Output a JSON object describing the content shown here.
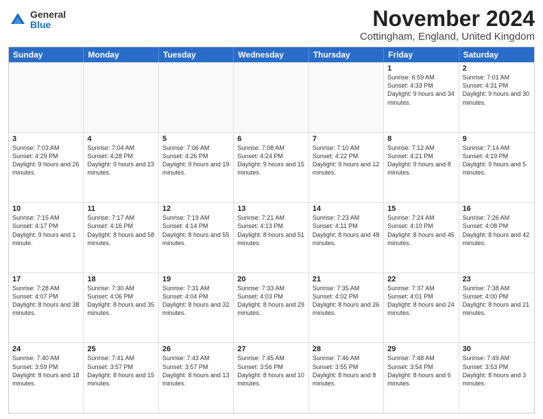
{
  "header": {
    "logo_general": "General",
    "logo_blue": "Blue",
    "month_title": "November 2024",
    "location": "Cottingham, England, United Kingdom"
  },
  "days_of_week": [
    "Sunday",
    "Monday",
    "Tuesday",
    "Wednesday",
    "Thursday",
    "Friday",
    "Saturday"
  ],
  "rows": [
    [
      {
        "day": "",
        "empty": true,
        "text": ""
      },
      {
        "day": "",
        "empty": true,
        "text": ""
      },
      {
        "day": "",
        "empty": true,
        "text": ""
      },
      {
        "day": "",
        "empty": true,
        "text": ""
      },
      {
        "day": "",
        "empty": true,
        "text": ""
      },
      {
        "day": "1",
        "empty": false,
        "text": "Sunrise: 6:59 AM\nSunset: 4:33 PM\nDaylight: 9 hours and 34 minutes."
      },
      {
        "day": "2",
        "empty": false,
        "text": "Sunrise: 7:01 AM\nSunset: 4:31 PM\nDaylight: 9 hours and 30 minutes."
      }
    ],
    [
      {
        "day": "3",
        "empty": false,
        "shaded": false,
        "text": "Sunrise: 7:03 AM\nSunset: 4:29 PM\nDaylight: 9 hours and 26 minutes."
      },
      {
        "day": "4",
        "empty": false,
        "text": "Sunrise: 7:04 AM\nSunset: 4:28 PM\nDaylight: 9 hours and 23 minutes."
      },
      {
        "day": "5",
        "empty": false,
        "text": "Sunrise: 7:06 AM\nSunset: 4:26 PM\nDaylight: 9 hours and 19 minutes."
      },
      {
        "day": "6",
        "empty": false,
        "text": "Sunrise: 7:08 AM\nSunset: 4:24 PM\nDaylight: 9 hours and 15 minutes."
      },
      {
        "day": "7",
        "empty": false,
        "text": "Sunrise: 7:10 AM\nSunset: 4:22 PM\nDaylight: 9 hours and 12 minutes."
      },
      {
        "day": "8",
        "empty": false,
        "text": "Sunrise: 7:12 AM\nSunset: 4:21 PM\nDaylight: 9 hours and 8 minutes."
      },
      {
        "day": "9",
        "empty": false,
        "text": "Sunrise: 7:14 AM\nSunset: 4:19 PM\nDaylight: 9 hours and 5 minutes."
      }
    ],
    [
      {
        "day": "10",
        "empty": false,
        "text": "Sunrise: 7:15 AM\nSunset: 4:17 PM\nDaylight: 9 hours and 1 minute."
      },
      {
        "day": "11",
        "empty": false,
        "text": "Sunrise: 7:17 AM\nSunset: 4:16 PM\nDaylight: 8 hours and 58 minutes."
      },
      {
        "day": "12",
        "empty": false,
        "text": "Sunrise: 7:19 AM\nSunset: 4:14 PM\nDaylight: 8 hours and 55 minutes."
      },
      {
        "day": "13",
        "empty": false,
        "text": "Sunrise: 7:21 AM\nSunset: 4:13 PM\nDaylight: 8 hours and 51 minutes."
      },
      {
        "day": "14",
        "empty": false,
        "text": "Sunrise: 7:23 AM\nSunset: 4:11 PM\nDaylight: 8 hours and 48 minutes."
      },
      {
        "day": "15",
        "empty": false,
        "text": "Sunrise: 7:24 AM\nSunset: 4:10 PM\nDaylight: 8 hours and 45 minutes."
      },
      {
        "day": "16",
        "empty": false,
        "text": "Sunrise: 7:26 AM\nSunset: 4:08 PM\nDaylight: 8 hours and 42 minutes."
      }
    ],
    [
      {
        "day": "17",
        "empty": false,
        "text": "Sunrise: 7:28 AM\nSunset: 4:07 PM\nDaylight: 8 hours and 38 minutes."
      },
      {
        "day": "18",
        "empty": false,
        "text": "Sunrise: 7:30 AM\nSunset: 4:06 PM\nDaylight: 8 hours and 35 minutes."
      },
      {
        "day": "19",
        "empty": false,
        "text": "Sunrise: 7:31 AM\nSunset: 4:04 PM\nDaylight: 8 hours and 32 minutes."
      },
      {
        "day": "20",
        "empty": false,
        "text": "Sunrise: 7:33 AM\nSunset: 4:03 PM\nDaylight: 8 hours and 29 minutes."
      },
      {
        "day": "21",
        "empty": false,
        "text": "Sunrise: 7:35 AM\nSunset: 4:02 PM\nDaylight: 8 hours and 26 minutes."
      },
      {
        "day": "22",
        "empty": false,
        "text": "Sunrise: 7:37 AM\nSunset: 4:01 PM\nDaylight: 8 hours and 24 minutes."
      },
      {
        "day": "23",
        "empty": false,
        "text": "Sunrise: 7:38 AM\nSunset: 4:00 PM\nDaylight: 8 hours and 21 minutes."
      }
    ],
    [
      {
        "day": "24",
        "empty": false,
        "text": "Sunrise: 7:40 AM\nSunset: 3:59 PM\nDaylight: 8 hours and 18 minutes."
      },
      {
        "day": "25",
        "empty": false,
        "text": "Sunrise: 7:41 AM\nSunset: 3:57 PM\nDaylight: 8 hours and 15 minutes."
      },
      {
        "day": "26",
        "empty": false,
        "text": "Sunrise: 7:43 AM\nSunset: 3:57 PM\nDaylight: 8 hours and 13 minutes."
      },
      {
        "day": "27",
        "empty": false,
        "text": "Sunrise: 7:45 AM\nSunset: 3:56 PM\nDaylight: 8 hours and 10 minutes."
      },
      {
        "day": "28",
        "empty": false,
        "text": "Sunrise: 7:46 AM\nSunset: 3:55 PM\nDaylight: 8 hours and 8 minutes."
      },
      {
        "day": "29",
        "empty": false,
        "text": "Sunrise: 7:48 AM\nSunset: 3:54 PM\nDaylight: 8 hours and 6 minutes."
      },
      {
        "day": "30",
        "empty": false,
        "text": "Sunrise: 7:49 AM\nSunset: 3:53 PM\nDaylight: 8 hours and 3 minutes."
      }
    ]
  ]
}
